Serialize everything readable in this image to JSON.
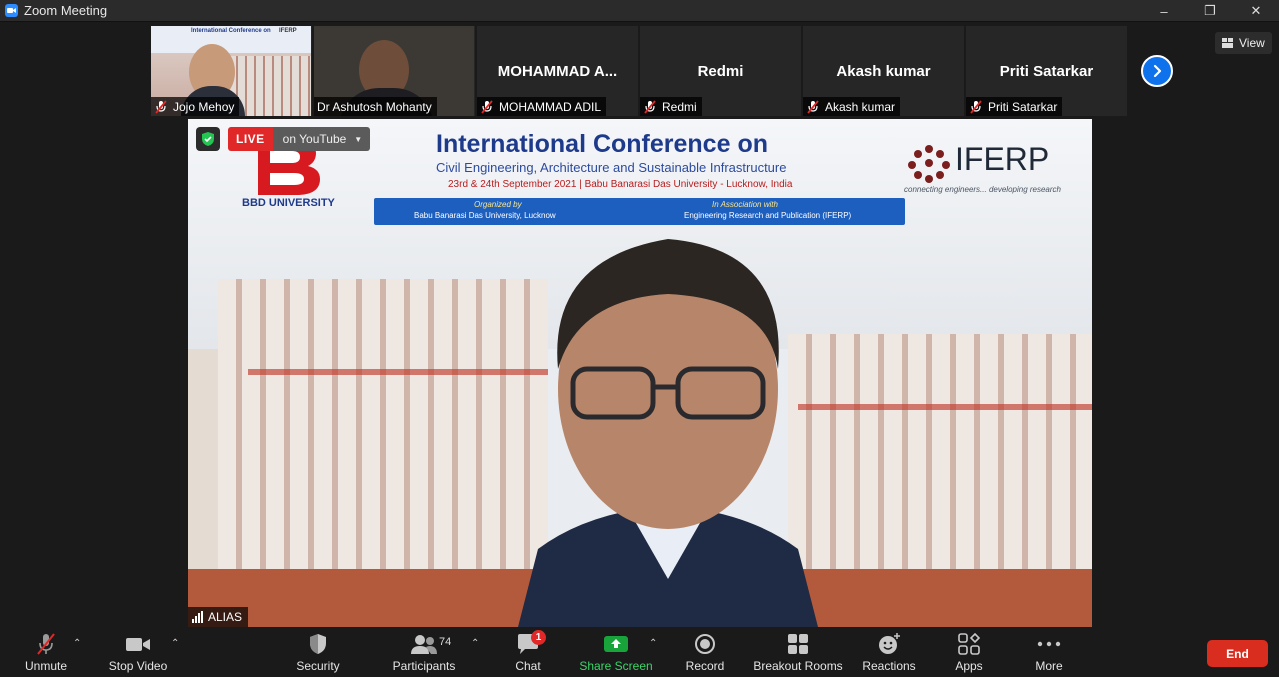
{
  "window": {
    "title": "Zoom Meeting",
    "minimize": "–",
    "restore": "❐",
    "close": "✕"
  },
  "view_button": {
    "label": "View"
  },
  "thumbnails": [
    {
      "caption": "Jojo Mehoy",
      "video": "conference"
    },
    {
      "caption": "Dr Ashutosh Mohanty",
      "video": "man"
    },
    {
      "display_name": "MOHAMMAD  A...",
      "caption": "MOHAMMAD ADIL"
    },
    {
      "display_name": "Redmi",
      "caption": "Redmi"
    },
    {
      "display_name": "Akash kumar",
      "caption": "Akash kumar"
    },
    {
      "display_name": "Priti Satarkar",
      "caption": "Priti Satarkar"
    }
  ],
  "thumb_conf_header": "International Conference on",
  "thumb_conf_logo": "IFERP",
  "main": {
    "live_label": "LIVE",
    "live_destination": "on YouTube",
    "speaker_name": "ALIAS",
    "banner": {
      "title": "International Conference on",
      "subtitle": "Civil Engineering, Architecture and Sustainable Infrastructure",
      "date_line": "23rd & 24th September 2021 | Babu Banarasi Das University - Lucknow, India",
      "org_left_label": "Organized by",
      "org_left_name": "Babu Banarasi Das University, Lucknow",
      "org_right_label": "In Association with",
      "org_right_name": "Engineering Research and Publication (IFERP)",
      "left_logo_text": "BBD UNIVERSITY",
      "right_logo_text": "IFERP",
      "right_logo_tagline": "connecting engineers... developing research"
    }
  },
  "toolbar": {
    "unmute": "Unmute",
    "stop_video": "Stop Video",
    "security": "Security",
    "participants": "Participants",
    "participants_count": "74",
    "chat": "Chat",
    "chat_badge": "1",
    "share_screen": "Share Screen",
    "record": "Record",
    "breakout_rooms": "Breakout Rooms",
    "reactions": "Reactions",
    "apps": "Apps",
    "more": "More",
    "end": "End",
    "caret": "⌃"
  },
  "colors": {
    "accent_blue": "#0e72ed",
    "live_red": "#e02828",
    "end_red": "#d92d20",
    "share_green": "#19a33b"
  }
}
